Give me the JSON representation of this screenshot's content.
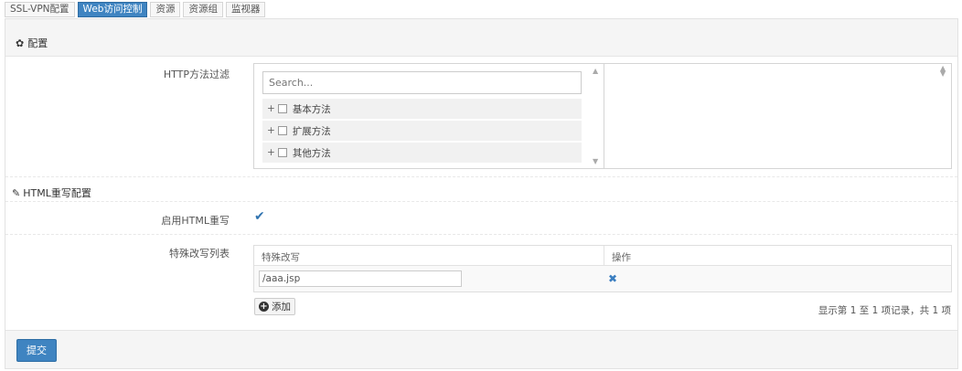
{
  "tabs": [
    {
      "label": "SSL-VPN配置",
      "active": false
    },
    {
      "label": "Web访问控制",
      "active": true
    },
    {
      "label": "资源",
      "active": false
    },
    {
      "label": "资源组",
      "active": false
    },
    {
      "label": "监视器",
      "active": false
    }
  ],
  "panel": {
    "title": "配置",
    "title_icon": "gear-icon"
  },
  "http_filter": {
    "label": "HTTP方法过滤",
    "search_placeholder": "Search...",
    "items": [
      {
        "label": "基本方法",
        "checked": false
      },
      {
        "label": "扩展方法",
        "checked": false
      },
      {
        "label": "其他方法",
        "checked": false
      }
    ]
  },
  "html_rewrite": {
    "section_title": "HTML重写配置",
    "section_icon": "pencil-icon",
    "enable_label": "启用HTML重写",
    "enabled": true,
    "list_label": "特殊改写列表",
    "columns": [
      "特殊改写",
      "操作"
    ],
    "rows": [
      {
        "value": "/aaa.jsp"
      }
    ],
    "add_label": "添加",
    "page_info": "显示第 1 至 1 项记录，共 1 项"
  },
  "footer": {
    "submit_label": "提交"
  },
  "colors": {
    "accent": "#3f84c1",
    "delete_icon": "#3b7ec0"
  }
}
